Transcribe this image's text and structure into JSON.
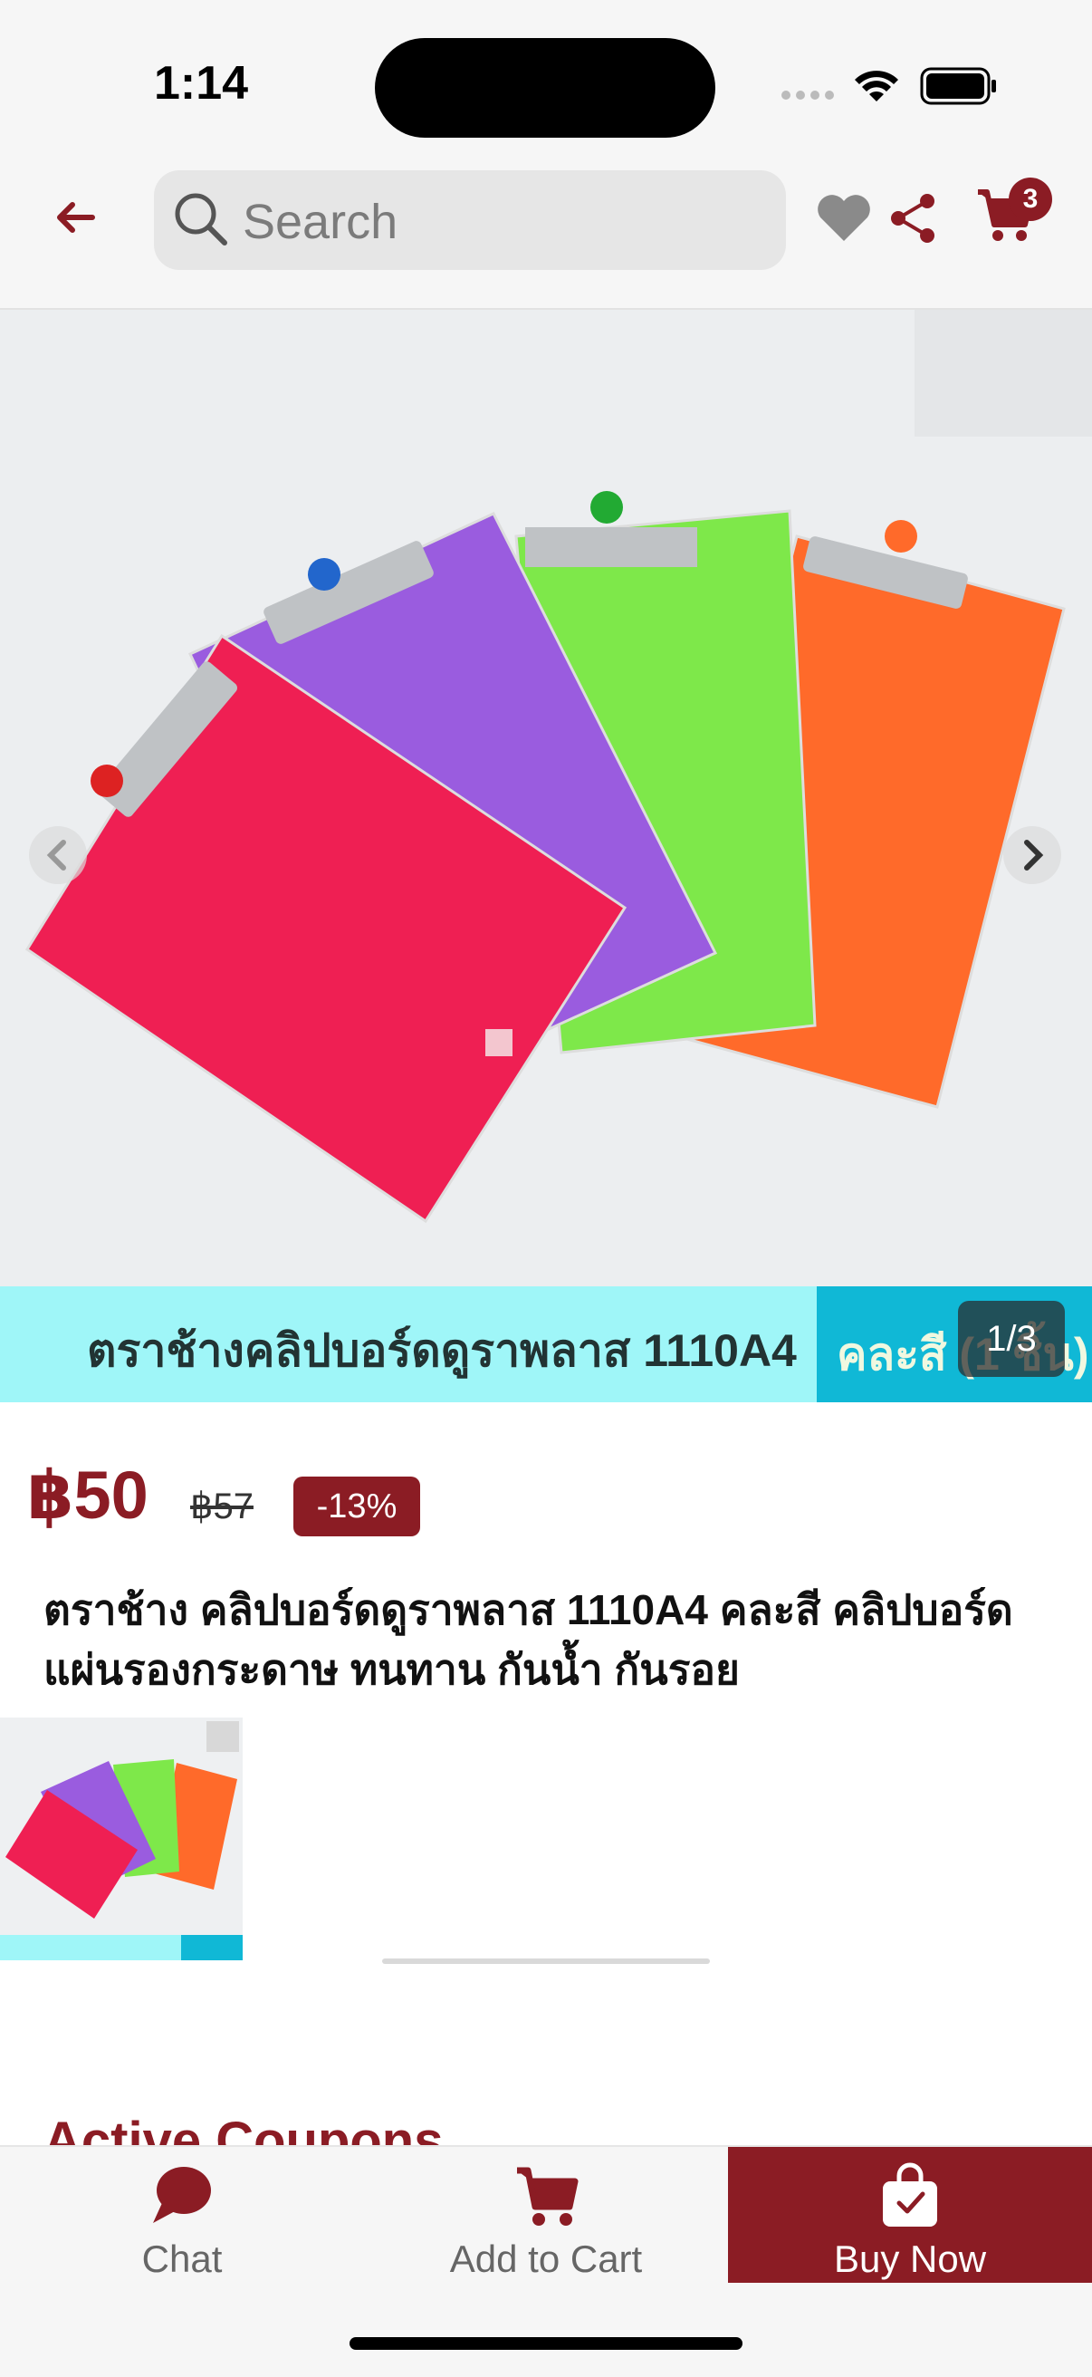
{
  "status_bar": {
    "time": "1:14"
  },
  "header": {
    "search_placeholder": "Search",
    "cart_count": "3"
  },
  "product": {
    "banner_text": "ตราช้างคลิปบอร์ดดูราพลาส 1110A4",
    "banner_text2": "คละสี (1 ชิ้น)",
    "image_counter": "1/3",
    "price": "฿50",
    "old_price": "฿57",
    "discount": "-13%",
    "title": "ตราช้าง คลิปบอร์ดดูราพลาส 1110A4 คละสี คลิปบอร์ด แผ่นรองกระดาษ ทนทาน กันน้ำ กันรอย"
  },
  "sections": {
    "coupons_title": "Active Coupons"
  },
  "bottom_bar": {
    "chat_label": "Chat",
    "add_to_cart_label": "Add to Cart",
    "buy_now_label": "Buy Now"
  },
  "colors": {
    "accent": "#8b1c24",
    "banner_bg": "#9ff6f8"
  },
  "icons": [
    "back-arrow-icon",
    "search-icon",
    "heart-icon",
    "share-icon",
    "cart-icon",
    "chat-icon",
    "add-cart-icon",
    "shopping-bag-icon",
    "chevron-left-icon",
    "chevron-right-icon",
    "wifi-icon",
    "battery-icon",
    "signal-icon"
  ]
}
